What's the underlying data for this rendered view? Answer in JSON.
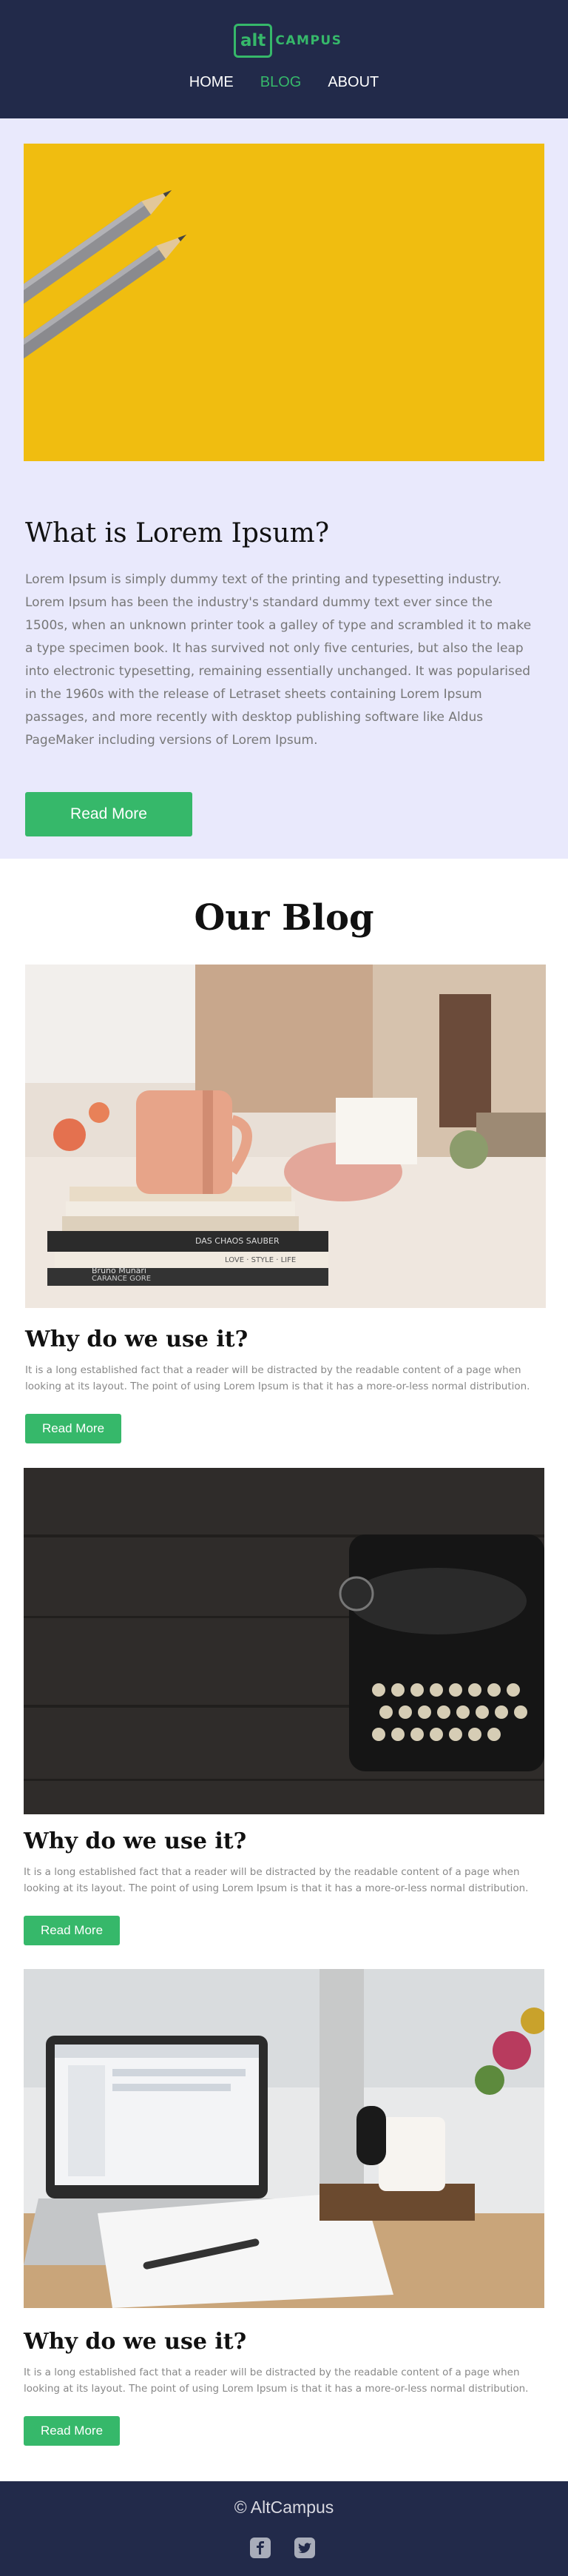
{
  "header": {
    "logo_box": "alt",
    "logo_text": "CAMPUS",
    "nav": [
      "HOME",
      "BLOG",
      "ABOUT"
    ]
  },
  "hero": {
    "title": "What is Lorem Ipsum?",
    "text": "Lorem Ipsum is simply dummy text of the printing and typesetting industry. Lorem Ipsum has been the industry's standard dummy text ever since the 1500s, when an unknown printer took a galley of type and scrambled it to make a type specimen book. It has survived not only five centuries, but also the leap into electronic typesetting, remaining essentially unchanged. It was popularised in the 1960s with the release of Letraset sheets containing Lorem Ipsum passages, and more recently with desktop publishing software like Aldus PageMaker including versions of Lorem Ipsum.",
    "button": "Read More"
  },
  "blog": {
    "title": "Our Blog",
    "posts": [
      {
        "title": "Why do we use it?",
        "text": "It is a long established fact that a reader will be distracted by the readable content of a page when looking at its layout. The point of using Lorem Ipsum is that it has a more-or-less normal distribution.",
        "button": "Read More"
      },
      {
        "title": "Why do we use it?",
        "text": "It is a long established fact that a reader will be distracted by the readable content of a page when looking at its layout. The point of using Lorem Ipsum is that it has a more-or-less normal distribution.",
        "button": "Read More"
      },
      {
        "title": "Why do we use it?",
        "text": "It is a long established fact that a reader will be distracted by the readable content of a page when looking at its layout. The point of using Lorem Ipsum is that it has a more-or-less normal distribution.",
        "button": "Read More"
      }
    ]
  },
  "book_spines": [
    "Bruno Munari",
    "DAS CHAOS SAUBER",
    "LOVE · STYLE · LIFE",
    "CARANCE GORE"
  ],
  "footer": {
    "copyright": "© AltCampus",
    "icons": [
      "facebook-icon",
      "twitter-icon"
    ]
  },
  "colors": {
    "navy": "#222a4a",
    "green": "#36b86a",
    "lavender": "#e9e9fc",
    "yellow": "#f3c112"
  }
}
